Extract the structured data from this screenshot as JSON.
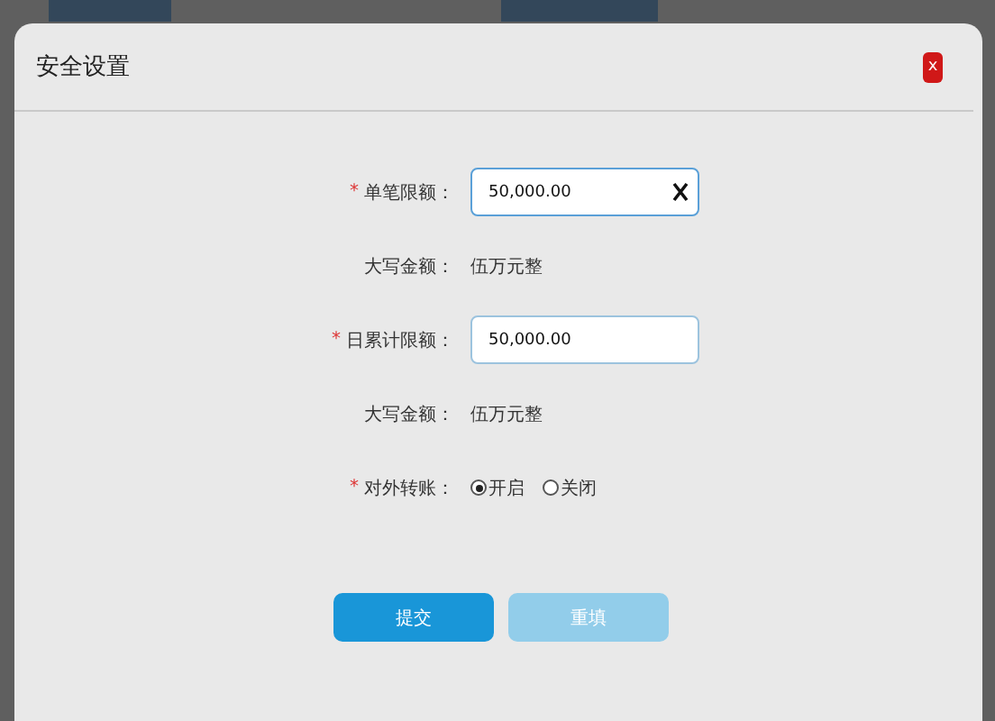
{
  "dialog": {
    "title": "安全设置",
    "close_label": "x"
  },
  "form": {
    "rows": [
      {
        "kind": "input",
        "mark": "*",
        "label": "单笔限额：",
        "value": "50,000.00",
        "focused": true
      },
      {
        "kind": "text",
        "label": "大写金额：",
        "value": "伍万元整"
      },
      {
        "kind": "input",
        "mark": "*",
        "label": "日累计限额：",
        "value": "50,000.00",
        "focused": false
      },
      {
        "kind": "text",
        "label": "大写金额：",
        "value": "伍万元整"
      },
      {
        "kind": "radio",
        "mark": "*",
        "label": "对外转账：",
        "options": [
          {
            "label": "开启",
            "selected": true
          },
          {
            "label": "关闭",
            "selected": false
          }
        ]
      }
    ]
  },
  "buttons": [
    {
      "label": "提交",
      "disabled": false
    },
    {
      "label": "重填",
      "disabled": true
    }
  ]
}
